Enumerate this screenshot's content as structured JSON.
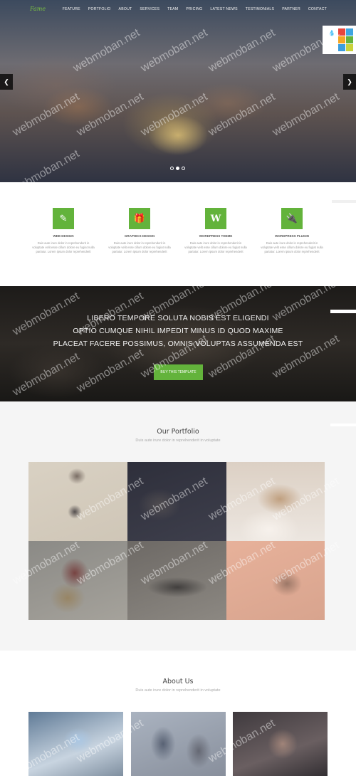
{
  "nav": {
    "logo": "Fame",
    "items": [
      "FEATURE",
      "PORTFOLIO",
      "ABOUT",
      "SERVICES",
      "TEAM",
      "PRICING",
      "LATEST NEWS",
      "TESTIMONIALS",
      "PARTNER",
      "CONTACT"
    ]
  },
  "hero": {
    "prev_icon": "chevron-left-icon",
    "next_icon": "chevron-right-icon",
    "slides": 3,
    "active_slide": 2
  },
  "style_switcher": {
    "icon": "droplet-icon",
    "colors": [
      "#e8453c",
      "#3da5e0",
      "#f5a623",
      "#63b33b",
      "#3b9ede",
      "#c9d23a"
    ]
  },
  "services": [
    {
      "icon": "pencil-icon",
      "title": "WEB DESIGN",
      "text": "Duis aute irure dolor in reprehenderit in voluptate velit esse cillum dolore eu fugiat nulla pariatur. Lorem ipsum dolor reprehenderit"
    },
    {
      "icon": "gift-icon",
      "title": "GRAPHICS DESIGN",
      "text": "Duis aute irure dolor in reprehenderit in voluptate velit esse cillum dolore eu fugiat nulla pariatur. Lorem ipsum dolor reprehenderit"
    },
    {
      "icon": "wordpress-icon",
      "title": "WORDPRESS THEME",
      "text": "Duis aute irure dolor in reprehenderit in voluptate velit esse cillum dolore eu fugiat nulla pariatur. Lorem ipsum dolor reprehenderit"
    },
    {
      "icon": "plug-icon",
      "title": "WORDPRESS PLUGIN",
      "text": "Duis aute irure dolor in reprehenderit in voluptate velit esse cillum dolore eu fugiat nulla pariatur. Lorem ipsum dolor reprehenderit"
    }
  ],
  "band": {
    "lines": [
      "LIBERO TEMPORE SOLUTA NOBIS EST ELIGENDI",
      "OPTIO CUMQUE NIHIL IMPEDIT MINUS ID QUOD MAXIME",
      "PLACEAT FACERE POSSIMUS, OMNIS VOLUPTAS ASSUMENDA EST"
    ],
    "button": "BUY THIS TEMPLATE"
  },
  "portfolio": {
    "title": "Our Portfolio",
    "subtitle": "Duis aute irure dolor in reprehenderit in voluptate"
  },
  "about": {
    "title": "About Us",
    "subtitle": "Duis aute irure dolor in reprehenderit in voluptate"
  },
  "colors": {
    "accent": "#63b33b",
    "logo": "#7ac142",
    "band_bg": "#2a2724"
  },
  "watermark": "webmoban.net"
}
